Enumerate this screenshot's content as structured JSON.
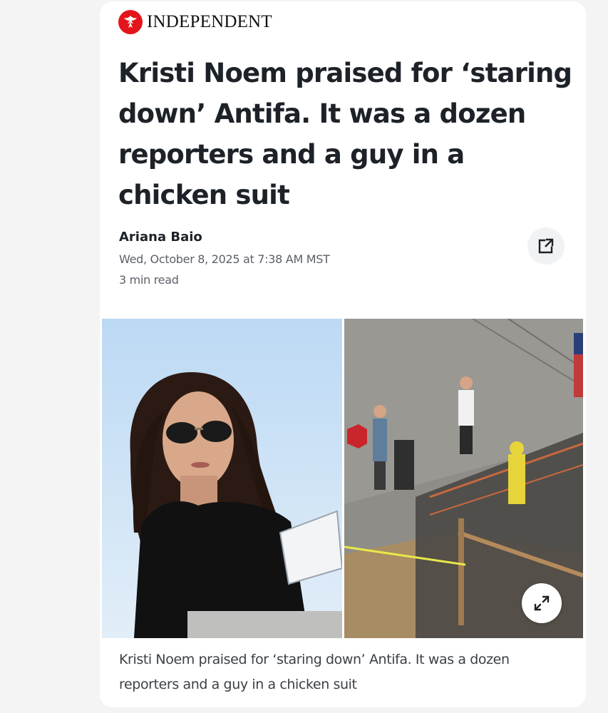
{
  "masthead": {
    "publication": "INDEPENDENT",
    "logo_icon": "eagle-icon",
    "brand_color": "#e4141b"
  },
  "article": {
    "headline": "Kristi Noem praised for ‘staring down’ Antifa. It was a dozen reporters and a guy in a chicken suit",
    "author": "Ariana Baio",
    "published": "Wed, October 8, 2025 at 7:38 AM MST",
    "read_time": "3 min read"
  },
  "actions": {
    "share_icon": "share-external-icon",
    "expand_icon": "expand-arrows-icon"
  },
  "media": {
    "caption": "Kristi Noem praised for ‘staring down’ Antifa. It was a dozen reporters and a guy in a chicken suit"
  },
  "colors": {
    "headline": "#1d2228",
    "meta": "#5b6068",
    "card_background": "#ffffff",
    "page_background": "#f4f4f4"
  }
}
